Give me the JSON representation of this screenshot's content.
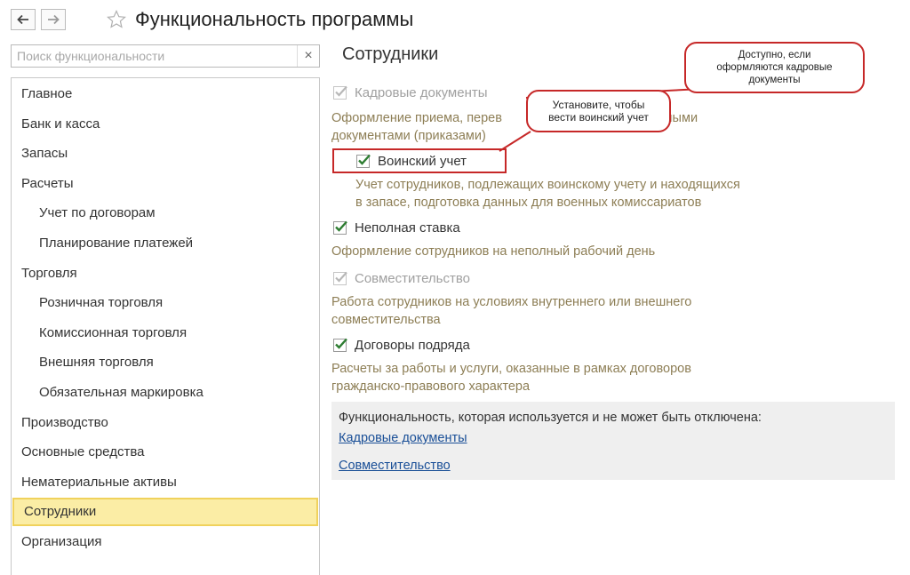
{
  "window": {
    "title": "Функциональность программы",
    "back_icon": "arrow-left-icon",
    "forward_icon": "arrow-right-icon",
    "favorite_icon": "star-icon"
  },
  "search": {
    "placeholder": "Поиск функциональности",
    "value": "",
    "clear_label": "×"
  },
  "sidebar": {
    "items": [
      {
        "label": "Главное",
        "indent": 0
      },
      {
        "label": "Банк и касса",
        "indent": 0
      },
      {
        "label": "Запасы",
        "indent": 0
      },
      {
        "label": "Расчеты",
        "indent": 0
      },
      {
        "label": "Учет по договорам",
        "indent": 1
      },
      {
        "label": "Планирование платежей",
        "indent": 1
      },
      {
        "label": "Торговля",
        "indent": 0
      },
      {
        "label": "Розничная торговля",
        "indent": 1
      },
      {
        "label": "Комиссионная торговля",
        "indent": 1
      },
      {
        "label": "Внешняя торговля",
        "indent": 1
      },
      {
        "label": "Обязательная маркировка",
        "indent": 1
      },
      {
        "label": "Производство",
        "indent": 0
      },
      {
        "label": "Основные средства",
        "indent": 0
      },
      {
        "label": "Нематериальные активы",
        "indent": 0
      },
      {
        "label": "Сотрудники",
        "indent": 0,
        "selected": true
      },
      {
        "label": "Организация",
        "indent": 0
      }
    ]
  },
  "main": {
    "heading": "Сотрудники",
    "options": [
      {
        "label": "Кадровые документы",
        "checked": true,
        "disabled": true,
        "desc": [
          "Оформление приема, перев",
          "ельными",
          "документами (приказами)"
        ]
      },
      {
        "label": "Воинский учет",
        "checked": true,
        "disabled": false,
        "desc": [
          "Учет сотрудников, подлежащих воинскому учету и находящихся",
          "в запасе, подготовка данных для военных комиссариатов"
        ]
      },
      {
        "label": "Неполная ставка",
        "checked": true,
        "disabled": false,
        "desc": [
          "Оформление сотрудников на неполный рабочий день"
        ]
      },
      {
        "label": "Совместительство",
        "checked": true,
        "disabled": true,
        "desc": [
          "Работа сотрудников на условиях внутреннего или внешнего",
          "совместительства"
        ]
      },
      {
        "label": "Договоры подряда",
        "checked": true,
        "disabled": false,
        "desc": [
          "Расчеты за работы и услуги, оказанные в рамках договоров",
          "гражданско-правового характера"
        ]
      }
    ],
    "info_panel": {
      "title": "Функциональность, которая используется и не может быть отключена:",
      "links": [
        "Кадровые документы",
        "Совместительство"
      ]
    }
  },
  "callouts": {
    "hr_docs": [
      "Доступно, если",
      "оформляются кадровые",
      "документы"
    ],
    "military": [
      "Установите, чтобы",
      "вести воинский учет"
    ]
  },
  "colors": {
    "accent_red": "#c62828",
    "selected_bg": "#fbeda5",
    "check_green": "#2e7d32",
    "link": "#1a4f97",
    "desc": "#8d7e55"
  }
}
